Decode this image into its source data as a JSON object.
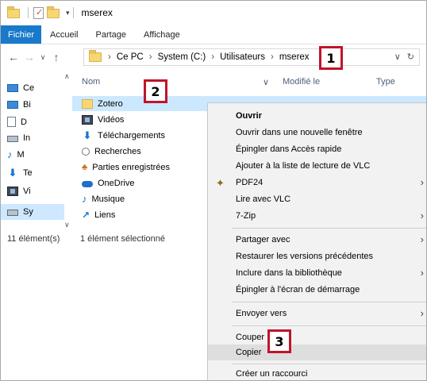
{
  "window": {
    "title": "mserex"
  },
  "ribbon": {
    "tabs": [
      "Fichier",
      "Accueil",
      "Partage",
      "Affichage"
    ]
  },
  "address": {
    "path": [
      "Ce PC",
      "System (C:)",
      "Utilisateurs",
      "mserex"
    ]
  },
  "sidebar": {
    "items": [
      "Ce",
      "Bi",
      "D",
      "In",
      "M",
      "Te",
      "Vi",
      "Sy"
    ]
  },
  "columns": {
    "name": "Nom",
    "modified": "Modifié le",
    "type": "Type"
  },
  "files": [
    {
      "name": "Zotero",
      "icon": "folder-icon",
      "selected": true
    },
    {
      "name": "Vidéos",
      "icon": "film-icon"
    },
    {
      "name": "Téléchargements",
      "icon": "download-icon"
    },
    {
      "name": "Recherches",
      "icon": "search-icon"
    },
    {
      "name": "Parties enregistrées",
      "icon": "saved-games-icon"
    },
    {
      "name": "OneDrive",
      "icon": "cloud-icon"
    },
    {
      "name": "Musique",
      "icon": "music-icon"
    },
    {
      "name": "Liens",
      "icon": "link-icon"
    }
  ],
  "status": {
    "count": "11 élément(s)",
    "selection": "1 élément sélectionné"
  },
  "context_menu": {
    "items": [
      {
        "label": "Ouvrir",
        "bold": true
      },
      {
        "label": "Ouvrir dans une nouvelle fenêtre"
      },
      {
        "label": "Épingler dans Accès rapide"
      },
      {
        "label": "Ajouter à la liste de lecture de VLC"
      },
      {
        "label": "PDF24",
        "submenu": true,
        "icon": "pdf24-icon"
      },
      {
        "label": "Lire avec VLC"
      },
      {
        "label": "7-Zip",
        "submenu": true
      },
      {
        "label": "Partager avec",
        "submenu": true
      },
      {
        "label": "Restaurer les versions précédentes"
      },
      {
        "label": "Inclure dans la bibliothèque",
        "submenu": true
      },
      {
        "label": "Épingler à l'écran de démarrage"
      },
      {
        "label": "Envoyer vers",
        "submenu": true
      },
      {
        "label": "Couper"
      },
      {
        "label": "Copier",
        "highlighted": true
      },
      {
        "label": "Créer un raccourci"
      }
    ]
  },
  "callouts": [
    "1",
    "2",
    "3"
  ],
  "colors": {
    "file_tab": "#1979ca",
    "selection": "#cce8ff",
    "callout_border": "#c0142a",
    "menu_bg": "#f2f2f2"
  }
}
